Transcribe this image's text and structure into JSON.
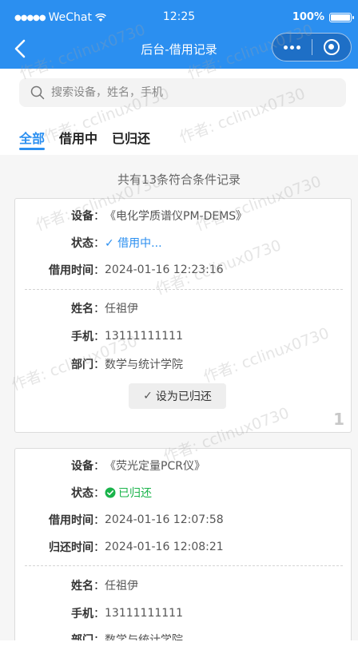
{
  "status_bar": {
    "carrier": "WeChat",
    "time": "12:25",
    "battery": "100%",
    "battery_level": 1.0
  },
  "nav": {
    "title": "后台-借用记录"
  },
  "search": {
    "placeholder": "搜索设备，姓名，手机"
  },
  "tabs": [
    {
      "label": "全部",
      "active": true
    },
    {
      "label": "借用中",
      "active": false
    },
    {
      "label": "已归还",
      "active": false
    }
  ],
  "summary": "共有13条符合条件记录",
  "labels": {
    "device": "设备",
    "status": "状态",
    "borrow_time": "借用时间",
    "return_time": "归还时间",
    "name": "姓名",
    "phone": "手机",
    "department": "部门",
    "colon": "："
  },
  "records": [
    {
      "device": "《电化学质谱仪PM-DEMS》",
      "status": "借用中...",
      "borrow_time": "2024-01-16 12:23:16",
      "name": "任祖伊",
      "phone": "13111111111",
      "department": "数学与统计学院",
      "action": "设为已归还",
      "index": "1"
    },
    {
      "device": "《荧光定量PCR仪》",
      "status": "已归还",
      "borrow_time": "2024-01-16 12:07:58",
      "return_time": "2024-01-16 12:08:21",
      "name": "任祖伊",
      "phone": "13111111111",
      "department": "数学与统计学院"
    }
  ],
  "watermark": "作者: cclinux0730",
  "colors": {
    "primary": "#2b8ff0",
    "returned": "#19b34a"
  }
}
